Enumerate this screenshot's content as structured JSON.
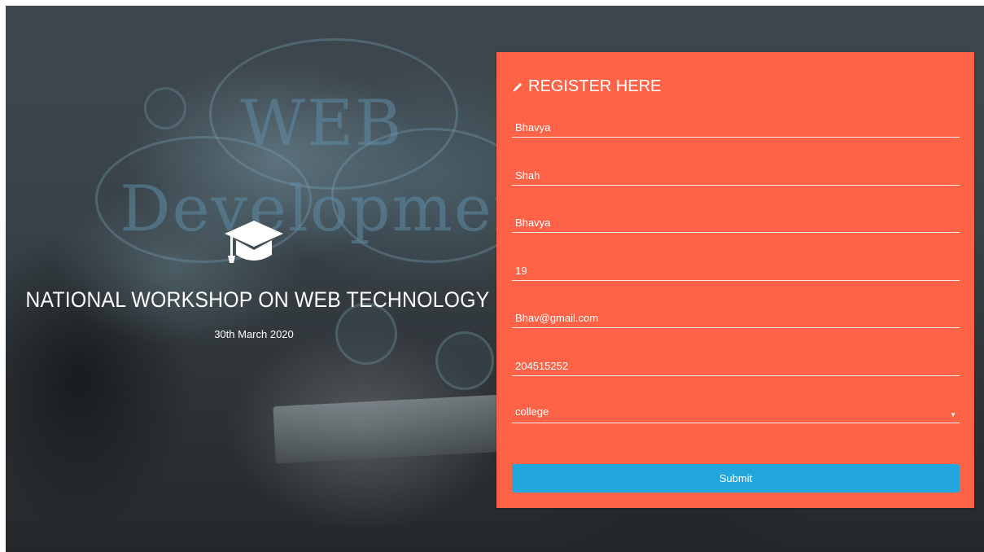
{
  "hero": {
    "title": "NATIONAL WORKSHOP ON WEB TECHNOLOGY",
    "date": "30th March 2020",
    "icon": "graduation-cap-icon",
    "background_words": [
      "WEB",
      "Developmen"
    ]
  },
  "form": {
    "header": "REGISTER HERE",
    "header_icon": "pencil-icon",
    "fields": [
      {
        "name": "first-name",
        "value": "Bhavya"
      },
      {
        "name": "last-name",
        "value": "Shah"
      },
      {
        "name": "username",
        "value": "Bhavya"
      },
      {
        "name": "age",
        "value": "19"
      },
      {
        "name": "email",
        "value": "Bhav@gmail.com"
      },
      {
        "name": "phone",
        "value": "204515252"
      }
    ],
    "select": {
      "value": "college",
      "icon": "caret-down-icon"
    },
    "submit_label": "Submit"
  },
  "colors": {
    "panel": "#ff6347",
    "button": "#22a7dd",
    "text": "#ffffff"
  }
}
